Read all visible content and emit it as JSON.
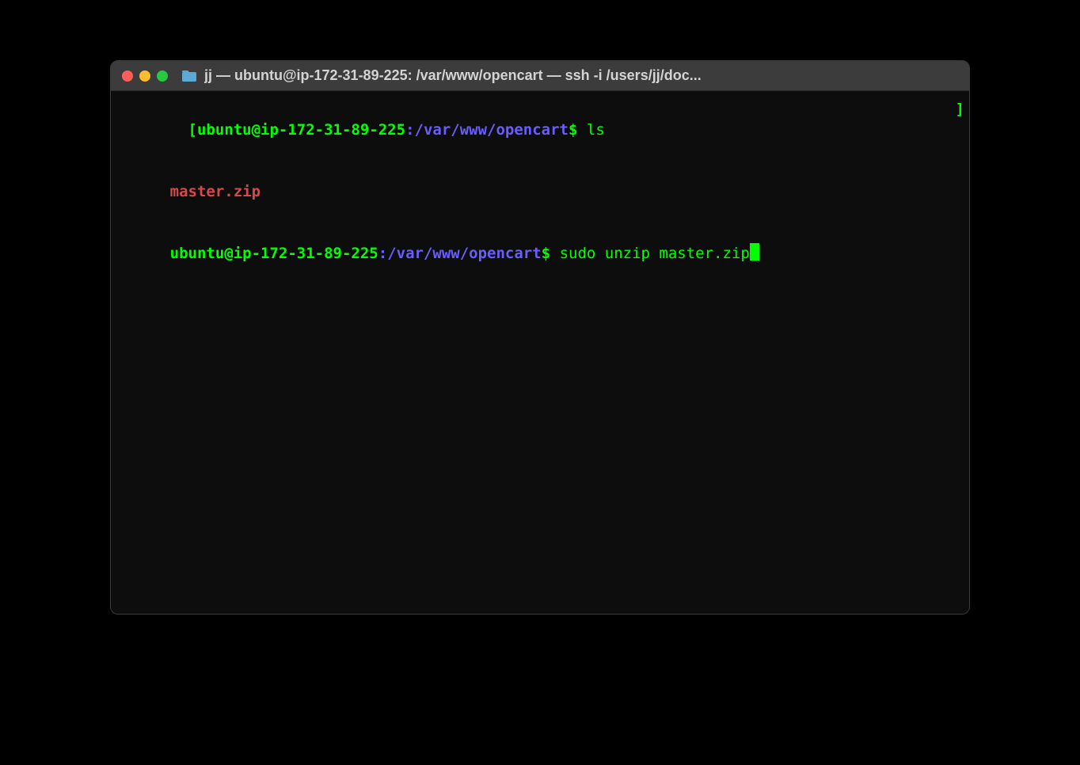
{
  "titlebar": {
    "title": "jj — ubuntu@ip-172-31-89-225: /var/www/opencart — ssh -i /users/jj/doc..."
  },
  "terminal": {
    "lines": [
      {
        "bracket_open": "[",
        "userhost": "ubuntu@ip-172-31-89-225",
        "colon": ":",
        "path": "/var/www/opencart",
        "dollar": "$",
        "command": " ls",
        "bracket_close": "]"
      },
      {
        "output": "master.zip"
      },
      {
        "userhost": "ubuntu@ip-172-31-89-225",
        "colon": ":",
        "path": "/var/www/opencart",
        "dollar": "$",
        "command": " sudo unzip master.zip"
      }
    ]
  }
}
